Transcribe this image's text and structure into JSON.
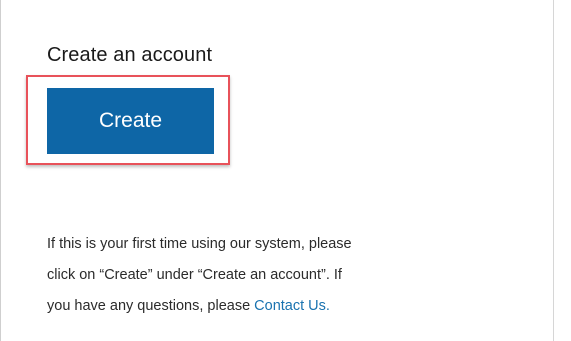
{
  "section": {
    "heading": "Create an account",
    "create_button_label": "Create"
  },
  "help": {
    "line1": "If this is your first time using our system, please",
    "line2": "click on “Create” under “Create an account”. If",
    "line3_prefix": "you have any questions, please ",
    "contact_link": "Contact Us."
  },
  "colors": {
    "button_bg": "#0e66a6",
    "highlight_border": "#e8525a",
    "link": "#1a73b0"
  }
}
